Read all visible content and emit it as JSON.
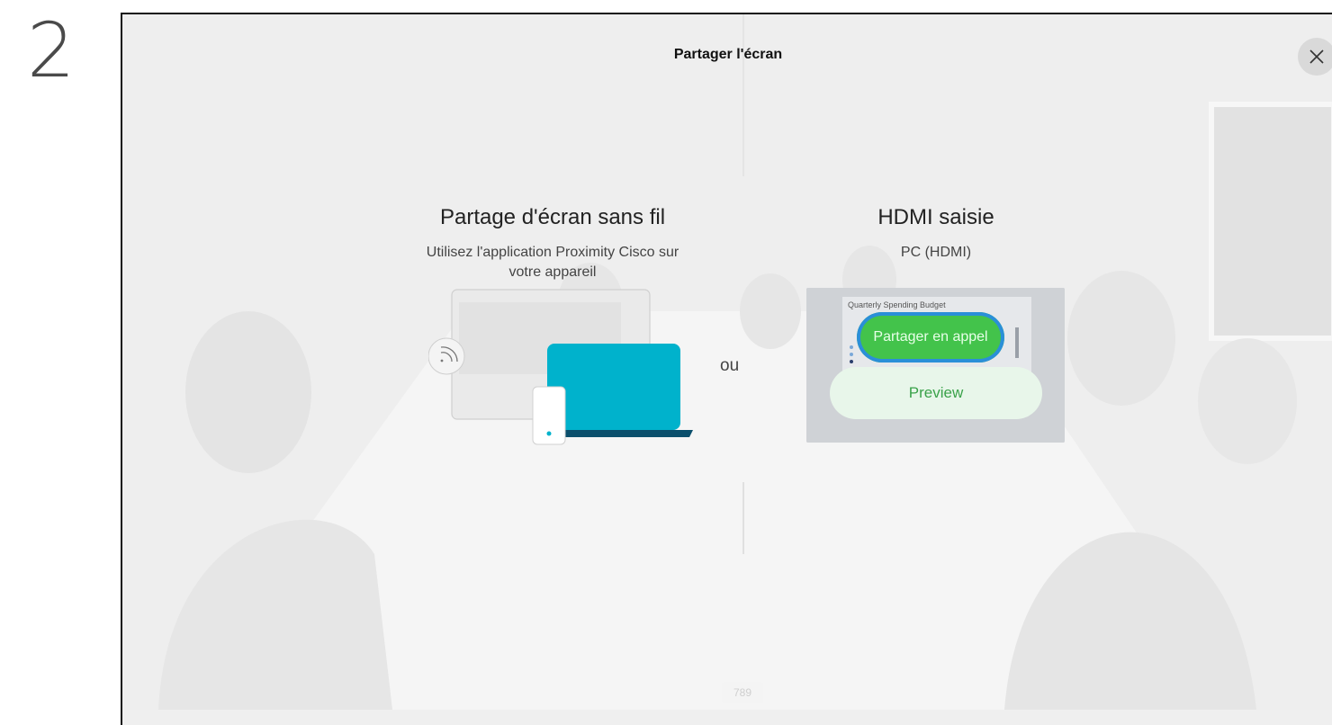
{
  "step": {
    "number": "2"
  },
  "header": {
    "title": "Partager l'écran"
  },
  "wireless": {
    "title": "Partage d'écran sans fil",
    "subtitle_line1": "Utilisez l'application Proximity Cisco sur",
    "subtitle_line2": "votre appareil"
  },
  "separator": {
    "label": "ou"
  },
  "hdmi": {
    "title": "HDMI saisie",
    "subtitle": "PC (HDMI)",
    "thumbnail_caption": "Quarterly Spending Budget",
    "share_label": "Partager en appel",
    "preview_label": "Preview"
  },
  "footer": {
    "badge": "789"
  },
  "icons": {
    "close": "close-icon",
    "wireless": "wireless-signal-icon"
  },
  "colors": {
    "laptop": "#00b2cc",
    "laptop_base": "#0b4f6c",
    "share_green": "#43c34b",
    "preview_text": "#3aa24a"
  }
}
